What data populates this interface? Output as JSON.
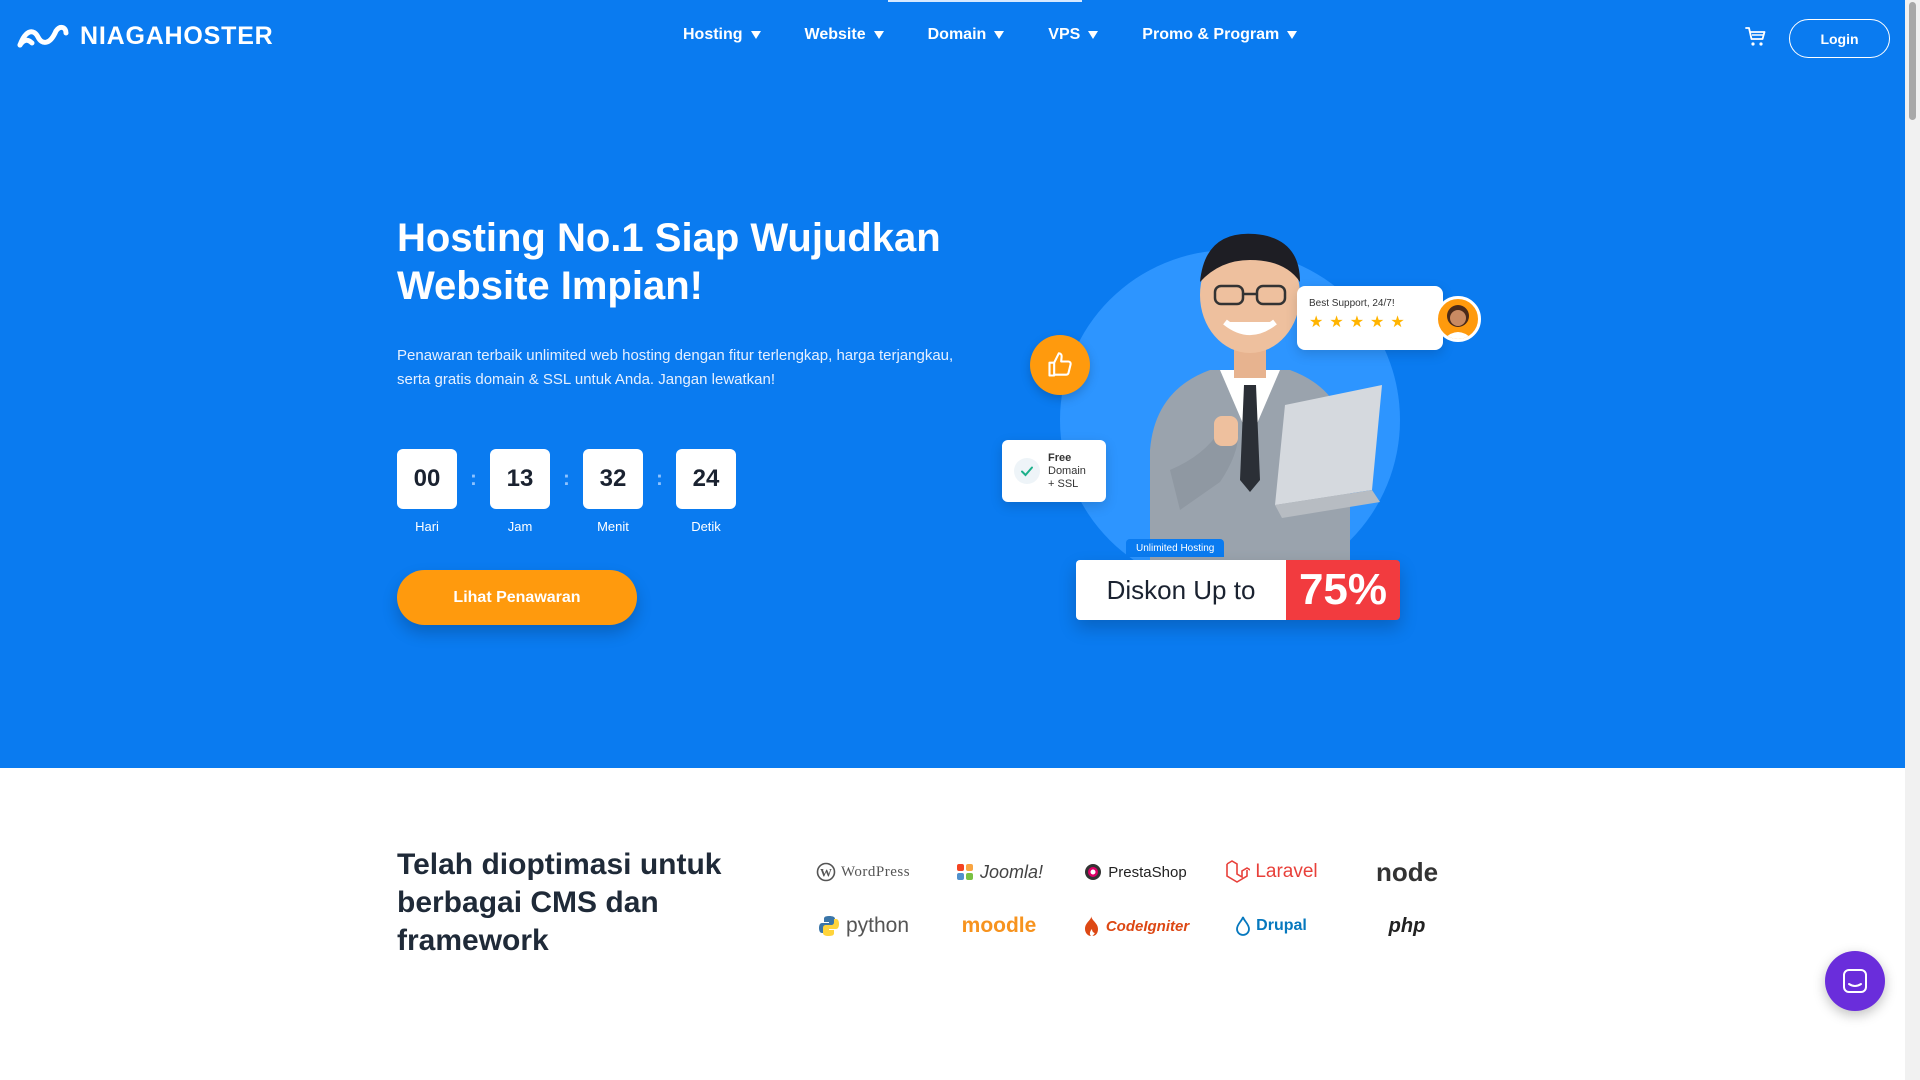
{
  "brand": {
    "name": "NIAGAHOSTER"
  },
  "nav": [
    {
      "label": "Hosting"
    },
    {
      "label": "Website"
    },
    {
      "label": "Domain"
    },
    {
      "label": "VPS"
    },
    {
      "label": "Promo & Program"
    }
  ],
  "header": {
    "login_label": "Login"
  },
  "hero": {
    "title": "Hosting No.1 Siap Wujudkan Website Impian!",
    "description": "Penawaran terbaik unlimited web hosting dengan fitur terlengkap, harga terjangkau, serta gratis domain & SSL untuk Anda. Jangan lewatkan!",
    "countdown": [
      {
        "value": "00",
        "label": "Hari"
      },
      {
        "value": "13",
        "label": "Jam"
      },
      {
        "value": "32",
        "label": "Menit"
      },
      {
        "value": "24",
        "label": "Detik"
      }
    ],
    "countdown_separator": ":",
    "cta_label": "Lihat Penawaran",
    "illustration": {
      "support_text": "Best Support, 24/7!",
      "rating_stars": 5,
      "free_line1": "Free",
      "free_line2": "Domain",
      "free_line3": "+ SSL",
      "tag_text": "Unlimited Hosting",
      "discount_text": "Diskon Up to",
      "discount_value": "75%"
    }
  },
  "cms": {
    "title": "Telah dioptimasi untuk berbagai CMS dan framework",
    "logos": [
      {
        "name": "WordPress"
      },
      {
        "name": "Joomla!"
      },
      {
        "name": "PrestaShop"
      },
      {
        "name": "Laravel"
      },
      {
        "name": "node"
      },
      {
        "name": "python"
      },
      {
        "name": "moodle"
      },
      {
        "name": "CodeIgniter"
      },
      {
        "name": "Drupal"
      },
      {
        "name": "php"
      }
    ]
  },
  "colors": {
    "hero_bg": "#0a7bf0",
    "cta": "#ff9a0d",
    "discount_red": "#f23b3f",
    "chat": "#6a2ddb"
  },
  "icons": {
    "cart": "cart-icon",
    "thumb": "thumbs-up-icon",
    "check": "check-icon",
    "chat": "chat-icon"
  }
}
